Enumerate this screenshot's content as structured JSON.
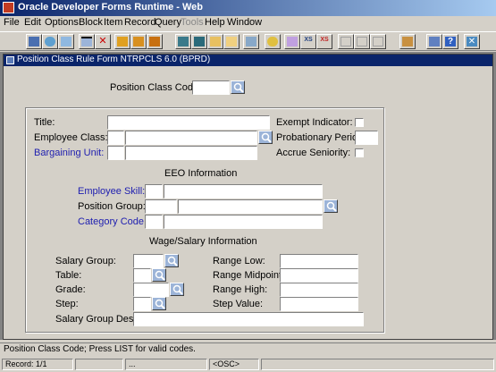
{
  "window": {
    "title": "Oracle Developer Forms Runtime - Web"
  },
  "menu": [
    "File",
    "Edit",
    "Options",
    "Block",
    "Item",
    "Record",
    "Query",
    "Tools",
    "Help",
    "Window"
  ],
  "menu_disabled": [
    "Tools"
  ],
  "toolbar": {
    "xs_label_1": "XS",
    "xs_label_2": "XS"
  },
  "form": {
    "title": "Position Class Rule Form  NTRPCLS  6.0  (BPRD)",
    "key_block": {
      "position_class_code_label": "Position Class Code:",
      "position_class_code_value": ""
    },
    "main": {
      "title_label": "Title:",
      "employee_class_label": "Employee Class:",
      "bargaining_unit_label": "Bargaining Unit:",
      "exempt_indicator_label": "Exempt Indicator:",
      "probationary_period_label": "Probationary Period:",
      "accrue_seniority_label": "Accrue Seniority:"
    },
    "eeo": {
      "header": "EEO Information",
      "employee_skill_label": "Employee Skill:",
      "position_group_label": "Position Group:",
      "category_code_label": "Category Code:"
    },
    "wage": {
      "header": "Wage/Salary Information",
      "salary_group_label": "Salary Group:",
      "table_label": "Table:",
      "grade_label": "Grade:",
      "step_label": "Step:",
      "salary_group_desc_label": "Salary Group Desc:",
      "range_low_label": "Range Low:",
      "range_midpoint_label": "Range Midpoint:",
      "range_high_label": "Range High:",
      "step_value_label": "Step Value:"
    }
  },
  "status": {
    "hint": "Position Class Code; Press LIST for valid codes.",
    "record": "Record: 1/1",
    "ellipsis": "...",
    "mode": "<OSC>"
  },
  "colors": {
    "title_bar": "#0a246a",
    "blue_label": "#2020b0",
    "canvas": "#d4d0c8",
    "workspace": "#838383"
  }
}
